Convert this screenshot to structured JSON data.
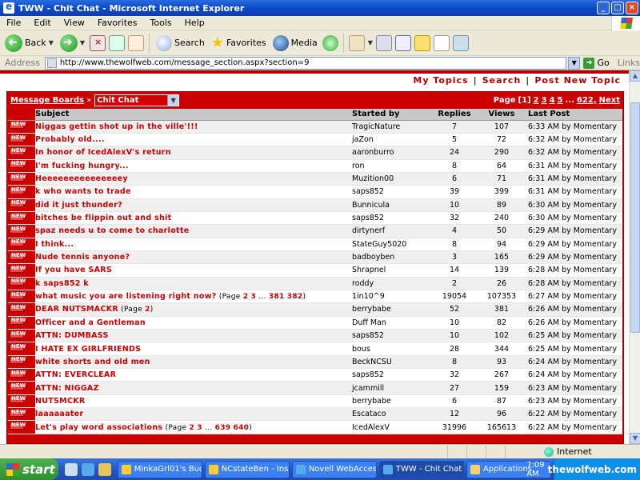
{
  "window": {
    "title": "TWW - Chit Chat - Microsoft Internet Explorer",
    "controls": [
      "_",
      "□",
      "×"
    ]
  },
  "menu": [
    "File",
    "Edit",
    "View",
    "Favorites",
    "Tools",
    "Help"
  ],
  "toolbar": {
    "back": "Back",
    "search": "Search",
    "favorites": "Favorites",
    "media": "Media"
  },
  "address": {
    "label": "Address",
    "url": "http://www.thewolfweb.com/message_section.aspx?section=9",
    "go": "Go",
    "links": "Links"
  },
  "page": {
    "top_links": [
      "My Topics",
      "Search",
      "Post New Topic"
    ],
    "breadcrumb": "Message Boards",
    "breadcrumb_sep": "»",
    "section_select": "Chit Chat",
    "pager": {
      "label": "Page",
      "current": "[1]",
      "pages": [
        "2",
        "3",
        "4",
        "5"
      ],
      "ellipsis": "...",
      "last": "622,",
      "next": "Next"
    },
    "columns": [
      "Subject",
      "Started by",
      "Replies",
      "Views",
      "Last Post"
    ],
    "topics": [
      {
        "subject": "Niggas gettin shot up in the ville'!!!",
        "by": "TragicNature",
        "replies": "7",
        "views": "107",
        "last": "6:33 AM by Momentary"
      },
      {
        "subject": "Probably old....",
        "by": "jaZon",
        "replies": "5",
        "views": "72",
        "last": "6:32 AM by Momentary"
      },
      {
        "subject": "In honor of IcedAlexV's return",
        "by": "aaronburro",
        "replies": "24",
        "views": "290",
        "last": "6:32 AM by Momentary"
      },
      {
        "subject": "I'm fucking hungry...",
        "by": "ron",
        "replies": "8",
        "views": "64",
        "last": "6:31 AM by Momentary"
      },
      {
        "subject": "Heeeeeeeeeeeeeeey",
        "by": "Muzition00",
        "replies": "6",
        "views": "71",
        "last": "6:31 AM by Momentary"
      },
      {
        "subject": "k who wants to trade",
        "by": "saps852",
        "replies": "39",
        "views": "399",
        "last": "6:31 AM by Momentary"
      },
      {
        "subject": "did it just thunder?",
        "by": "Bunnicula",
        "replies": "10",
        "views": "89",
        "last": "6:30 AM by Momentary"
      },
      {
        "subject": "bitches be flippin out and shit",
        "by": "saps852",
        "replies": "32",
        "views": "240",
        "last": "6:30 AM by Momentary"
      },
      {
        "subject": "spaz needs u to come to charlotte",
        "by": "dirtynerf",
        "replies": "4",
        "views": "50",
        "last": "6:29 AM by Momentary"
      },
      {
        "subject": "I think...",
        "by": "StateGuy5020",
        "replies": "8",
        "views": "94",
        "last": "6:29 AM by Momentary"
      },
      {
        "subject": "Nude tennis anyone?",
        "by": "badboyben",
        "replies": "3",
        "views": "165",
        "last": "6:29 AM by Momentary"
      },
      {
        "subject": "If you have SARS",
        "by": "Shrapnel",
        "replies": "14",
        "views": "139",
        "last": "6:28 AM by Momentary"
      },
      {
        "subject": "k saps852 k",
        "by": "roddy",
        "replies": "2",
        "views": "26",
        "last": "6:28 AM by Momentary"
      },
      {
        "subject": "what music you are listening right now?",
        "pages": "(Page",
        "page_links": [
          "2",
          "3",
          "...",
          "381",
          "382"
        ],
        "pages_end": ")",
        "by": "1in10^9",
        "replies": "19054",
        "views": "107353",
        "last": "6:27 AM by Momentary"
      },
      {
        "subject": "DEAR NUTSMACKR",
        "pages": "(Page",
        "page_links": [
          "2"
        ],
        "pages_end": ")",
        "by": "berrybabe",
        "replies": "52",
        "views": "381",
        "last": "6:26 AM by Momentary"
      },
      {
        "subject": "Officer and a Gentleman",
        "by": "Duff Man",
        "replies": "10",
        "views": "82",
        "last": "6:26 AM by Momentary"
      },
      {
        "subject": "ATTN: DUMBASS",
        "by": "saps852",
        "replies": "10",
        "views": "102",
        "last": "6:25 AM by Momentary"
      },
      {
        "subject": "I HATE EX GIRLFRIENDS",
        "by": "bous",
        "replies": "28",
        "views": "344",
        "last": "6:25 AM by Momentary"
      },
      {
        "subject": "white shorts and old men",
        "by": "BeckNCSU",
        "replies": "8",
        "views": "93",
        "last": "6:24 AM by Momentary"
      },
      {
        "subject": "ATTN: EVERCLEAR",
        "by": "saps852",
        "replies": "32",
        "views": "267",
        "last": "6:24 AM by Momentary"
      },
      {
        "subject": "ATTN: NIGGAZ",
        "by": "jcammill",
        "replies": "27",
        "views": "159",
        "last": "6:23 AM by Momentary"
      },
      {
        "subject": "NUTSMCKR",
        "by": "berrybabe",
        "replies": "6",
        "views": "87",
        "last": "6:23 AM by Momentary"
      },
      {
        "subject": "laaaaaater",
        "by": "Escataco",
        "replies": "12",
        "views": "96",
        "last": "6:22 AM by Momentary"
      },
      {
        "subject": "Let's play word associations",
        "pages": "(Page",
        "page_links": [
          "2",
          "3",
          "...",
          "639",
          "640"
        ],
        "pages_end": ")",
        "by": "IcedAlexV",
        "replies": "31996",
        "views": "165613",
        "last": "6:22 AM by Momentary"
      }
    ]
  },
  "status": {
    "zone": "Internet"
  },
  "taskbar": {
    "start": "start",
    "tasks": [
      "MinkaGrl01's Bud...",
      "NCstateBen - Ins...",
      "Novell WebAcces...",
      "TWW - Chit Chat ...",
      "Applications"
    ],
    "time": "7:09 AM",
    "watermark": "thewolfweb.com"
  },
  "colors": {
    "accent": "#cc0000",
    "title_bar": "#0a48c8",
    "chrome": "#ece9d8"
  }
}
